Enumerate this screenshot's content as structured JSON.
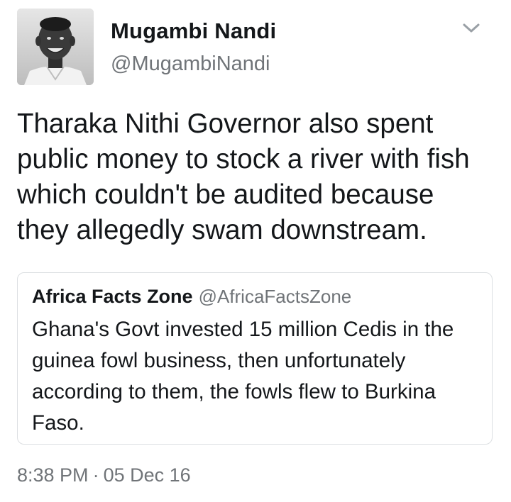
{
  "author": {
    "display_name": "Mugambi Nandi",
    "handle": "@MugambiNandi"
  },
  "tweet": {
    "text": "Tharaka Nithi Governor also spent\npublic money to stock a river with fish\nwhich couldn't be audited because\nthey allegedly swam downstream."
  },
  "quoted_tweet": {
    "display_name": "Africa Facts Zone",
    "handle": "@AfricaFactsZone",
    "text": "Ghana's Govt invested 15 million Cedis in the\nguinea fowl business, then unfortunately\naccording to them, the fowls flew to Burkina\nFaso."
  },
  "meta": {
    "time": "8:38 PM",
    "separator": "·",
    "date": "05 Dec 16"
  },
  "icons": {
    "menu": "chevron-down-icon"
  },
  "colors": {
    "text_primary": "#14171a",
    "text_secondary": "#707478",
    "border": "#dcdfe2"
  }
}
